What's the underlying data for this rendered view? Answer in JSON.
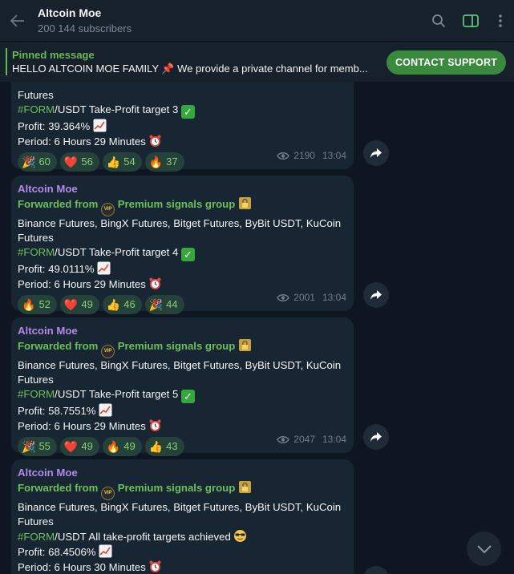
{
  "header": {
    "title": "Altcoin Moe",
    "subscribers": "200 144 subscribers"
  },
  "pinned": {
    "title": "Pinned message",
    "text": "HELLO ALTCOIN MOE FAMILY  📌 We provide a private channel for memb...",
    "button": "CONTACT SUPPORT"
  },
  "messages": [
    {
      "lines": [
        "Futures",
        "#FORM/USDT Take-Profit target 3",
        "Profit: 39.364%",
        "Period: 6 Hours 29 Minutes"
      ],
      "reactions": [
        {
          "icon": "🎉",
          "count": "60"
        },
        {
          "icon": "❤️",
          "count": "56"
        },
        {
          "icon": "👍",
          "count": "54"
        },
        {
          "icon": "🔥",
          "count": "37"
        }
      ],
      "views": "2190",
      "time": "13:04"
    },
    {
      "author": "Altcoin Moe",
      "forwarded_prefix": "Forwarded from",
      "forwarded_source": "Premium signals group",
      "exchanges": "Binance Futures, BingX Futures, Bitget Futures, ByBit USDT, KuCoin",
      "exchanges_2": "Futures",
      "hashtag": "#FORM",
      "target_line": "/USDT Take-Profit target 4",
      "profit": "Profit: 49.0111%",
      "period": "Period: 6 Hours 29 Minutes",
      "reactions": [
        {
          "icon": "🔥",
          "count": "52"
        },
        {
          "icon": "❤️",
          "count": "49"
        },
        {
          "icon": "👍",
          "count": "46"
        },
        {
          "icon": "🎉",
          "count": "44"
        }
      ],
      "views": "2001",
      "time": "13:04"
    },
    {
      "author": "Altcoin Moe",
      "forwarded_prefix": "Forwarded from",
      "forwarded_source": "Premium signals group",
      "exchanges": "Binance Futures, BingX Futures, Bitget Futures, ByBit USDT, KuCoin",
      "exchanges_2": "Futures",
      "hashtag": "#FORM",
      "target_line": "/USDT Take-Profit target 5",
      "profit": "Profit: 58.7551%",
      "period": "Period: 6 Hours 29 Minutes",
      "reactions": [
        {
          "icon": "🎉",
          "count": "55"
        },
        {
          "icon": "❤️",
          "count": "49"
        },
        {
          "icon": "🔥",
          "count": "49"
        },
        {
          "icon": "👍",
          "count": "43"
        }
      ],
      "views": "2047",
      "time": "13:04"
    },
    {
      "author": "Altcoin Moe",
      "forwarded_prefix": "Forwarded from",
      "forwarded_source": "Premium signals group",
      "exchanges": "Binance Futures, BingX Futures, Bitget Futures, ByBit USDT, KuCoin",
      "exchanges_2": "Futures",
      "hashtag": "#FORM",
      "target_line": "/USDT All take-profit targets achieved",
      "profit": "Profit: 68.4506%",
      "period": "Period: 6 Hours 30 Minutes"
    }
  ],
  "icons": {
    "vip_badge": "VIP"
  },
  "colors": {
    "background": "#0e1621",
    "bubble": "#182533",
    "author": "#b38ae8",
    "forwarded": "#6cc05a",
    "contact_button": "#3a8a3e"
  }
}
